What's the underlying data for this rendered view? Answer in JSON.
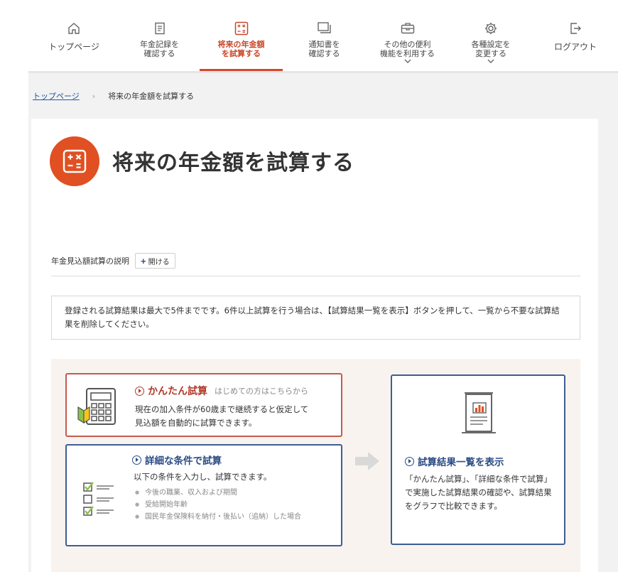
{
  "nav": {
    "items": [
      {
        "label": "トップページ",
        "icon": "home-icon",
        "active": false,
        "chevron": false
      },
      {
        "label": "年金記録を\n確認する",
        "icon": "document-icon",
        "active": false,
        "chevron": false
      },
      {
        "label": "将来の年金額\nを試算する",
        "icon": "calculator-icon",
        "active": true,
        "chevron": false
      },
      {
        "label": "通知書を\n確認する",
        "icon": "notice-stack-icon",
        "active": false,
        "chevron": false
      },
      {
        "label": "その他の便利\n機能を利用する",
        "icon": "briefcase-icon",
        "active": false,
        "chevron": true
      },
      {
        "label": "各種設定を\n変更する",
        "icon": "gear-icon",
        "active": false,
        "chevron": true
      },
      {
        "label": "ログアウト",
        "icon": "logout-icon",
        "active": false,
        "chevron": false
      }
    ]
  },
  "breadcrumb": {
    "home": "トップページ",
    "sep": "›",
    "current": "将来の年金額を試算する"
  },
  "page": {
    "title": "将来の年金額を試算する"
  },
  "explanation": {
    "label": "年金見込額試算の説明",
    "button_plus": "+",
    "button_label": "開ける"
  },
  "notice": {
    "text": "登録される試算結果は最大で5件までです。6件以上試算を行う場合は、【試算結果一覧を表示】ボタンを押して、一覧から不要な試算結果を削除してください。"
  },
  "simple": {
    "title": "かんたん試算",
    "subtitle": "はじめての方はこちらから",
    "desc1": "現在の加入条件が60歳まで継続すると仮定して",
    "desc2": "見込額を自動的に試算できます。"
  },
  "detailed": {
    "title": "詳細な条件で試算",
    "desc": "以下の条件を入力し、試算できます。",
    "items": [
      "今後の職業、収入および期間",
      "受給開始年齢",
      "国民年金保険料を納付・後払い（追納）した場合"
    ]
  },
  "results": {
    "title": "試算結果一覧を表示",
    "desc": "「かんたん試算」、「詳細な条件で試算」で実施した試算結果の確認や、試算結果をグラフで比較できます。"
  },
  "colors": {
    "accent": "#d6482c",
    "title_icon": "#e05022",
    "blue": "#2b4c86",
    "red": "#b23a2a",
    "beige": "#f8f3ee"
  }
}
